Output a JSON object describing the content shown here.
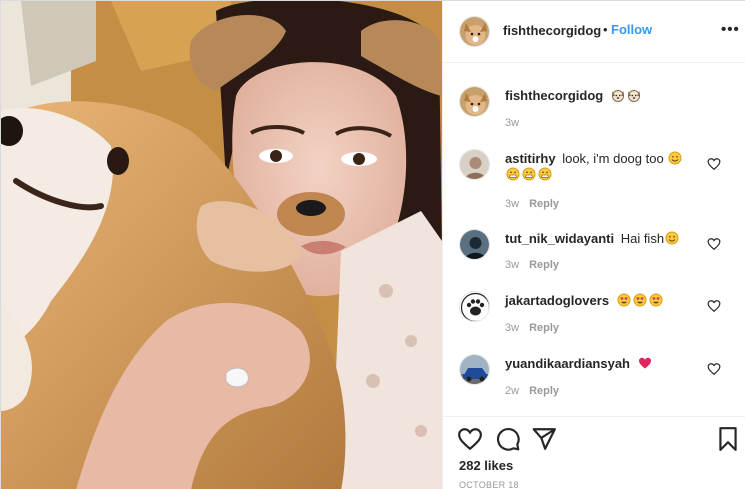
{
  "post": {
    "author": {
      "username": "fishthecorgidog",
      "separator": "•",
      "follow_label": "Follow",
      "more_label": "•••",
      "avatar_icon": "corgi-avatar-icon"
    },
    "caption": {
      "username": "fishthecorgidog",
      "emoji": [
        "dog-face-emoji",
        "dog-face-emoji"
      ],
      "time": "3w"
    },
    "comments": [
      {
        "username": "astitirhy",
        "text": "look, i'm doog too",
        "emoji": [
          "smiling-face-emoji",
          "grimacing-face-emoji",
          "grimacing-face-emoji",
          "grimacing-face-emoji"
        ],
        "time": "3w",
        "reply_label": "Reply",
        "avatar_icon": "user-avatar-icon"
      },
      {
        "username": "tut_nik_widayanti",
        "text": "Hai fish",
        "emoji": [
          "smiling-face-emoji"
        ],
        "time": "3w",
        "reply_label": "Reply",
        "avatar_icon": "user-avatar-icon"
      },
      {
        "username": "jakartadoglovers",
        "text": "",
        "emoji": [
          "heart-eyes-emoji",
          "heart-eyes-emoji",
          "heart-eyes-emoji"
        ],
        "time": "3w",
        "reply_label": "Reply",
        "avatar_icon": "paw-avatar-icon"
      },
      {
        "username": "yuandikaardiansyah",
        "text": "",
        "emoji": [
          "red-heart-emoji"
        ],
        "time": "2w",
        "reply_label": "Reply",
        "avatar_icon": "car-avatar-icon"
      }
    ],
    "likes": "282 likes",
    "date": "OCTOBER 18",
    "colors": {
      "link": "#3897f0",
      "text": "#262626",
      "muted": "#999999",
      "divider": "#efefef"
    }
  }
}
